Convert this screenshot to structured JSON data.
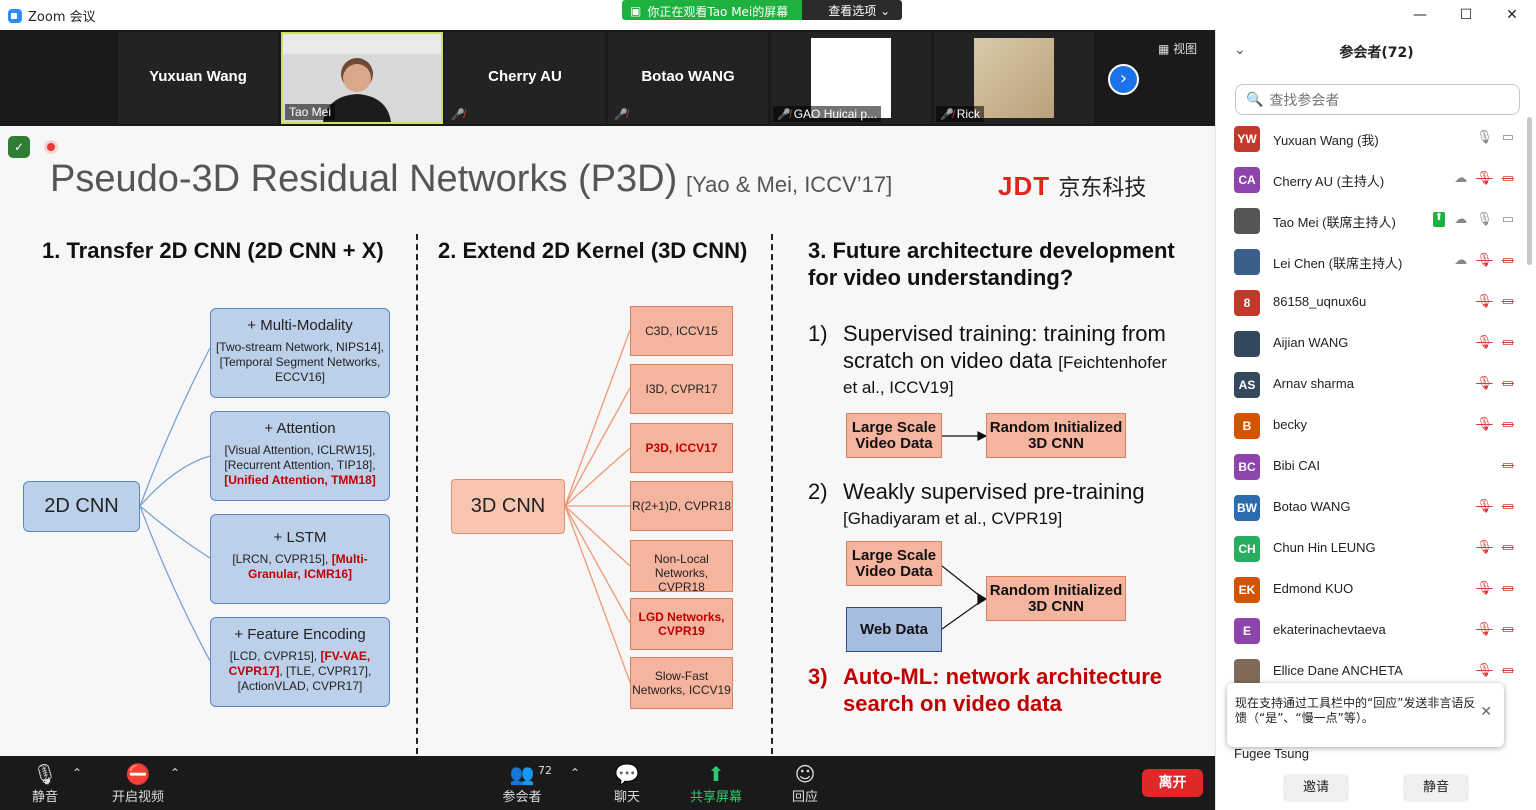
{
  "window": {
    "title": "Zoom 会议",
    "controls": [
      "—",
      "☐",
      "✕"
    ]
  },
  "share_banner": {
    "text": "你正在观看Tao Mei的屏幕",
    "options": "查看选项 ⌄"
  },
  "video_strip": {
    "tiles": [
      {
        "name": "Yuxuan Wang"
      },
      {
        "label": "Tao Mei"
      },
      {
        "name": "Cherry AU"
      },
      {
        "name": "Botao WANG"
      },
      {
        "label": "GAO Huicai p..."
      },
      {
        "label": "Rick"
      }
    ],
    "view_label": "视图",
    "next": "›"
  },
  "slide": {
    "title": "Pseudo-3D Residual Networks (P3D)",
    "citation": "[Yao & Mei, ICCV’17]",
    "logo_a": "JDT",
    "logo_b": "京东科技",
    "col1": {
      "heading": "1. Transfer 2D CNN (2D CNN + X)",
      "root": "2D CNN",
      "boxes": [
        {
          "title": "+ Multi-Modality",
          "body": "[Two-stream Network, NIPS14], [Temporal Segment Networks, ECCV16]"
        },
        {
          "title": "+ Attention",
          "body": "[Visual Attention, ICLRW15], [Recurrent Attention, TIP18],",
          "red": "[Unified Attention, TMM18]"
        },
        {
          "title": "+ LSTM",
          "body": "[LRCN, CVPR15],",
          "red": "[Multi-Granular, ICMR16]"
        },
        {
          "title": "+ Feature Encoding",
          "body": "[LCD, CVPR15],",
          "red": "[FV-VAE, CVPR17]",
          "body2": ", [TLE, CVPR17], [ActionVLAD, CVPR17]"
        }
      ]
    },
    "col2": {
      "heading": "2. Extend 2D Kernel (3D CNN)",
      "root": "3D CNN",
      "boxes": [
        "C3D, ICCV15",
        "I3D, CVPR17",
        "P3D, ICCV17",
        "R(2+1)D, CVPR18",
        "Non-Local Networks, CVPR18",
        "LGD Networks, CVPR19",
        "Slow-Fast Networks, ICCV19"
      ]
    },
    "col3": {
      "heading1": "3. Future architecture development",
      "heading2": "for video understanding?",
      "item1_num": "1)",
      "item1_line1": "Supervised training: training from",
      "item1_line2": "scratch on video data",
      "item1_cite_a": "[Feichtenhofer",
      "item1_cite_b": "et al., ICCV19]",
      "item2_num": "2)",
      "item2_line1": "Weakly supervised pre-training",
      "item2_cite": "[Ghadiyaram et al., CVPR19]",
      "item3_num": "3)",
      "item3_line1": "Auto-ML: network architecture",
      "item3_line2": "search on video data",
      "large_scale": "Large Scale Video Data",
      "random_init": "Random Initialized 3D CNN",
      "web_data": "Web Data"
    }
  },
  "toolbar": {
    "mute": "静音",
    "video": "开启视频",
    "participants": "参会者",
    "participants_count": "72",
    "chat": "聊天",
    "share": "共享屏幕",
    "reactions": "回应",
    "leave": "离开"
  },
  "panel": {
    "title": "参会者(72)",
    "search_placeholder": "查找参会者",
    "participants": [
      {
        "initials": "YW",
        "name": "Yuxuan Wang (我)",
        "color": "#c0392b"
      },
      {
        "initials": "CA",
        "name": "Cherry AU (主持人)",
        "color": "#8e44ad"
      },
      {
        "initials": "",
        "name": "Tao Mei (联席主持人)",
        "color": "#555555"
      },
      {
        "initials": "",
        "name": "Lei Chen (联席主持人)",
        "color": "#3a5f8a"
      },
      {
        "initials": "8",
        "name": "86158_uqnux6u",
        "color": "#c0392b"
      },
      {
        "initials": "",
        "name": "Aijian WANG",
        "color": "#34495e"
      },
      {
        "initials": "AS",
        "name": "Arnav sharma",
        "color": "#34495e"
      },
      {
        "initials": "B",
        "name": "becky",
        "color": "#d35400"
      },
      {
        "initials": "BC",
        "name": "Bibi CAI",
        "color": "#8e44ad"
      },
      {
        "initials": "BW",
        "name": "Botao WANG",
        "color": "#2b6cb0"
      },
      {
        "initials": "CH",
        "name": "Chun Hin LEUNG",
        "color": "#27ae60"
      },
      {
        "initials": "EK",
        "name": "Edmond KUO",
        "color": "#d35400"
      },
      {
        "initials": "E",
        "name": "ekaterinachevtaeva",
        "color": "#8e44ad"
      },
      {
        "initials": "",
        "name": "Ellice Dane ANCHETA",
        "color": "#7f6a5a"
      }
    ],
    "partial_name": "Fugee Tsung",
    "tooltip": "现在支持通过工具栏中的“回应”发送非言语反馈（“是”、“慢一点”等）。",
    "invite": "邀请",
    "mute_all": "静音"
  }
}
